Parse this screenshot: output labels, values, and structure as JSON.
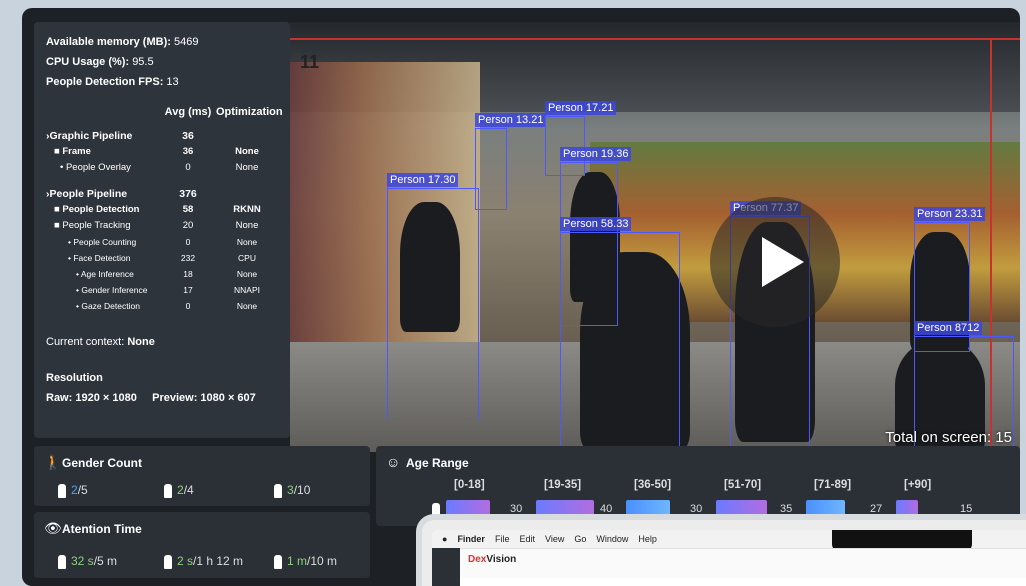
{
  "stats": {
    "memory_label": "Available memory (MB):",
    "memory_value": "5469",
    "cpu_label": "CPU Usage (%):",
    "cpu_value": "95.5",
    "fps_label": "People Detection FPS:",
    "fps_value": "13"
  },
  "pipeline_table": {
    "col_avg": "Avg (ms)",
    "col_opt": "Optimization",
    "rows": [
      {
        "name": "›Graphic Pipeline",
        "avg": "36",
        "opt": ""
      },
      {
        "name": "■ Frame",
        "avg": "36",
        "opt": "None"
      },
      {
        "name": "• People Overlay",
        "avg": "0",
        "opt": "None"
      },
      {
        "name": "›People Pipeline",
        "avg": "376",
        "opt": ""
      },
      {
        "name": "■ People Detection",
        "avg": "58",
        "opt": "RKNN"
      },
      {
        "name": "■ People Tracking",
        "avg": "20",
        "opt": "None"
      },
      {
        "name": "• People Counting",
        "avg": "0",
        "opt": "None"
      },
      {
        "name": "• Face Detection",
        "avg": "232",
        "opt": "CPU"
      },
      {
        "name": "• Age Inference",
        "avg": "18",
        "opt": "None"
      },
      {
        "name": "• Gender Inference",
        "avg": "17",
        "opt": "NNAPI"
      },
      {
        "name": "• Gaze Detection",
        "avg": "0",
        "opt": "None"
      }
    ]
  },
  "context": {
    "label": "Current context:",
    "value": "None"
  },
  "resolution": {
    "title": "Resolution",
    "raw_label": "Raw:",
    "raw_value": "1920 × 1080",
    "preview_label": "Preview:",
    "preview_value": "1080 × 607"
  },
  "video": {
    "frame_number": "11",
    "total_label": "Total on screen: 15",
    "boxes": [
      {
        "label": "Person 17.30"
      },
      {
        "label": "Person 13.21"
      },
      {
        "label": "Person 17.21"
      },
      {
        "label": "Person 19.36"
      },
      {
        "label": "Person 58.33"
      },
      {
        "label": "Person 77.37"
      },
      {
        "label": "Person 23.31"
      },
      {
        "label": "Person 8712"
      }
    ]
  },
  "gender_count": {
    "title": "Gender Count",
    "items": [
      {
        "hl": "2",
        "rest": "/5"
      },
      {
        "hl": "2",
        "rest": "/4"
      },
      {
        "hl": "3",
        "rest": "/10"
      }
    ]
  },
  "attention_time": {
    "title": "Atention Time",
    "items": [
      {
        "hl": "32 s",
        "rest": "/5 m"
      },
      {
        "hl": "2 s",
        "rest": "/1 h 12 m"
      },
      {
        "hl": "1 m",
        "rest": "/10 m"
      }
    ]
  },
  "age_range": {
    "title": "Age Range",
    "ranges": [
      "[0-18]",
      "[19-35]",
      "[36-50]",
      "[51-70]",
      "[71-89]",
      "[+90]"
    ],
    "values": [
      30,
      40,
      30,
      35,
      27,
      15
    ]
  },
  "laptop": {
    "menu": [
      "Finder",
      "File",
      "Edit",
      "View",
      "Go",
      "Window",
      "Help"
    ],
    "brand_a": "Dex",
    "brand_b": "Vision"
  },
  "colors": {
    "box": "#4d58ff",
    "accent_blue": "#4ea1ff",
    "accent_green": "#8ad07a"
  }
}
